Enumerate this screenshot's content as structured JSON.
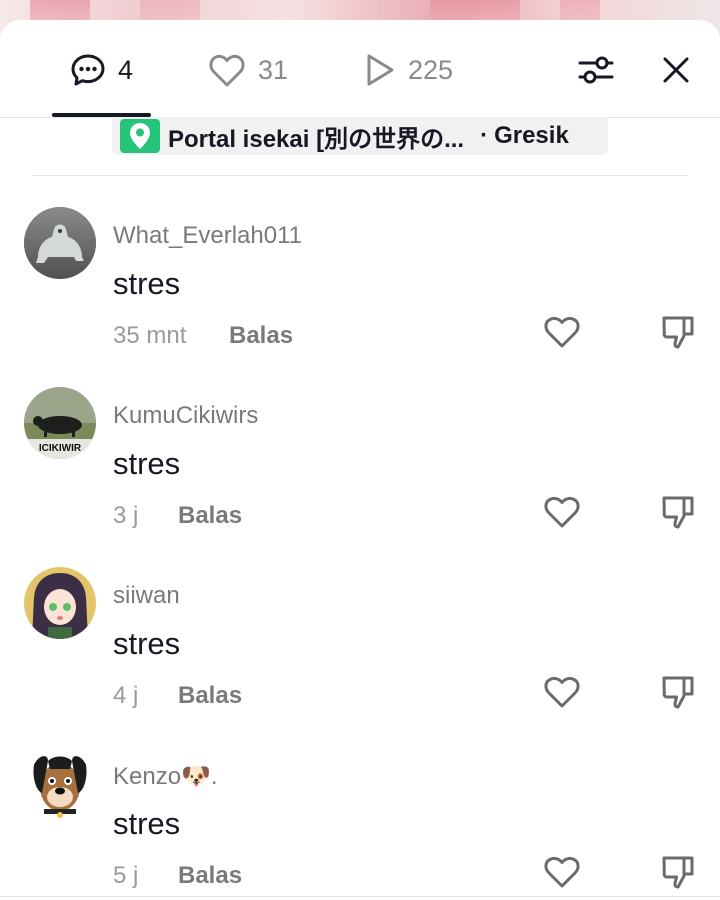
{
  "header": {
    "tabs": [
      {
        "icon": "comment-icon",
        "count": "4"
      },
      {
        "icon": "heart-icon",
        "count": "31"
      },
      {
        "icon": "play-icon",
        "count": "225"
      }
    ],
    "filter_icon": "filter-sliders-icon",
    "close_icon": "close-icon"
  },
  "location": {
    "name": "Portal isekai [別の世界の...",
    "separator": "·",
    "city": "Gresik",
    "pin_color": "#25c47a"
  },
  "comments": [
    {
      "username": "What_Everlah011",
      "text": "stres",
      "time": "35 mnt",
      "reply": "Balas"
    },
    {
      "username": "KumuCikiwirs",
      "text": "stres",
      "time": "3 j",
      "reply": "Balas"
    },
    {
      "username": "siiwan",
      "text": "stres",
      "time": "4 j",
      "reply": "Balas"
    },
    {
      "username": "Kenzo🐶.",
      "text": "stres",
      "time": "5 j",
      "reply": "Balas"
    }
  ],
  "colors": {
    "text_primary": "#161823",
    "text_secondary": "#7a7a7a",
    "accent_green": "#25c47a"
  }
}
